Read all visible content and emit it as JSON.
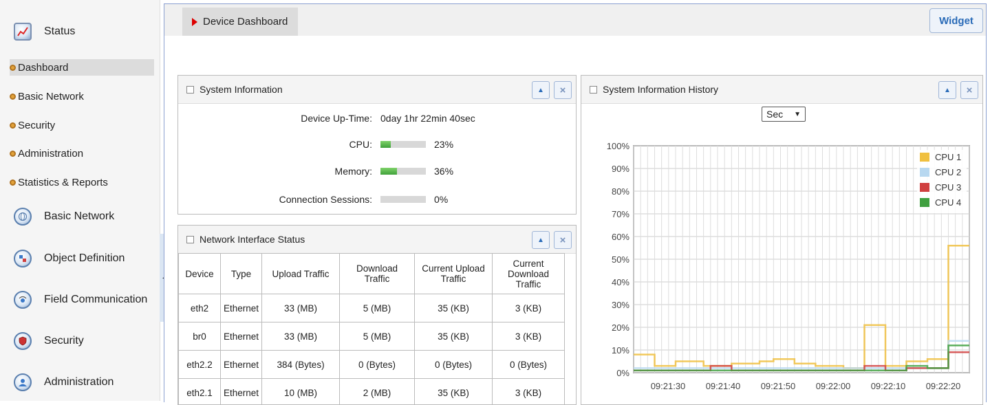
{
  "sidebar": {
    "status_label": "Status",
    "sub_items": [
      {
        "label": "Dashboard",
        "active": true
      },
      {
        "label": "Basic Network",
        "active": false
      },
      {
        "label": "Security",
        "active": false
      },
      {
        "label": "Administration",
        "active": false
      },
      {
        "label": "Statistics & Reports",
        "active": false
      }
    ],
    "sections": [
      {
        "label": "Basic Network",
        "icon": "globe-icon"
      },
      {
        "label": "Object Definition",
        "icon": "object-icon"
      },
      {
        "label": "Field Communication",
        "icon": "field-communication-icon"
      },
      {
        "label": "Security",
        "icon": "shield-icon"
      },
      {
        "label": "Administration",
        "icon": "admin-user-icon"
      }
    ]
  },
  "header": {
    "page_title": "Device Dashboard",
    "widget_label": "Widget"
  },
  "system_info": {
    "title": "System Information",
    "uptime_label": "Device Up-Time:",
    "uptime_value": "0day 1hr 22min 40sec",
    "cpu_label": "CPU:",
    "cpu_value": "23%",
    "cpu_fraction": 0.23,
    "memory_label": "Memory:",
    "memory_value": "36%",
    "memory_fraction": 0.36,
    "sessions_label": "Connection Sessions:",
    "sessions_value": "0%",
    "sessions_fraction": 0.0
  },
  "network": {
    "title": "Network Interface Status",
    "headers": [
      "Device",
      "Type",
      "Upload Traffic",
      "Download Traffic",
      "Current Upload Traffic",
      "Current Download Traffic"
    ],
    "rows": [
      [
        "eth2",
        "Ethernet",
        "33 (MB)",
        "5 (MB)",
        "35 (KB)",
        "3 (KB)"
      ],
      [
        "br0",
        "Ethernet",
        "33 (MB)",
        "5 (MB)",
        "35 (KB)",
        "3 (KB)"
      ],
      [
        "eth2.2",
        "Ethernet",
        "384 (Bytes)",
        "0 (Bytes)",
        "0 (Bytes)",
        "0 (Bytes)"
      ],
      [
        "eth2.1",
        "Ethernet",
        "10 (MB)",
        "2 (MB)",
        "35 (KB)",
        "3 (KB)"
      ]
    ]
  },
  "history": {
    "title": "System Information History",
    "interval_selected": "Sec"
  },
  "colors": {
    "cpu1": "#f0c040",
    "cpu2": "#b8d8f0",
    "cpu3": "#d04040",
    "cpu4": "#40a040",
    "accent": "#2a6bb8"
  },
  "chart_data": {
    "type": "line",
    "yticks": [
      "100%",
      "90%",
      "80%",
      "70%",
      "60%",
      "50%",
      "40%",
      "30%",
      "20%",
      "10%",
      "0%"
    ],
    "xticks": [
      "09:21:30",
      "09:21:40",
      "09:21:50",
      "09:22:00",
      "09:22:10",
      "09:22:20"
    ],
    "ylim": [
      0,
      100
    ],
    "legend_position": "top-right",
    "grid": true,
    "series": [
      {
        "name": "CPU 1",
        "color": "#f0c040",
        "values": [
          8,
          8,
          8,
          3,
          3,
          3,
          5,
          5,
          5,
          5,
          3,
          3,
          3,
          3,
          4,
          4,
          4,
          4,
          5,
          5,
          6,
          6,
          6,
          4,
          4,
          4,
          3,
          3,
          3,
          3,
          2,
          2,
          2,
          21,
          21,
          21,
          3,
          3,
          3,
          5,
          5,
          5,
          6,
          6,
          6,
          56,
          56,
          56
        ]
      },
      {
        "name": "CPU 2",
        "color": "#b8d8f0",
        "values": [
          2,
          2,
          2,
          2,
          2,
          2,
          2,
          2,
          2,
          2,
          2,
          2,
          2,
          2,
          2,
          2,
          2,
          2,
          2,
          2,
          2,
          2,
          2,
          2,
          2,
          2,
          2,
          2,
          2,
          2,
          2,
          2,
          2,
          2,
          2,
          2,
          2,
          2,
          2,
          2,
          2,
          2,
          2,
          2,
          2,
          14,
          14,
          14
        ]
      },
      {
        "name": "CPU 3",
        "color": "#d04040",
        "values": [
          1,
          1,
          1,
          1,
          1,
          1,
          1,
          1,
          1,
          1,
          1,
          3,
          3,
          3,
          1,
          1,
          1,
          1,
          1,
          1,
          1,
          1,
          1,
          1,
          1,
          1,
          1,
          1,
          1,
          1,
          1,
          1,
          1,
          3,
          3,
          3,
          1,
          1,
          1,
          2,
          2,
          2,
          2,
          2,
          2,
          9,
          9,
          9
        ]
      },
      {
        "name": "CPU 4",
        "color": "#40a040",
        "values": [
          1,
          1,
          1,
          1,
          1,
          1,
          1,
          1,
          1,
          1,
          1,
          1,
          1,
          1,
          1,
          1,
          1,
          1,
          1,
          1,
          1,
          1,
          1,
          1,
          1,
          1,
          1,
          1,
          1,
          1,
          1,
          1,
          1,
          1,
          1,
          1,
          1,
          1,
          1,
          3,
          3,
          3,
          2,
          2,
          2,
          12,
          12,
          12
        ]
      }
    ]
  }
}
